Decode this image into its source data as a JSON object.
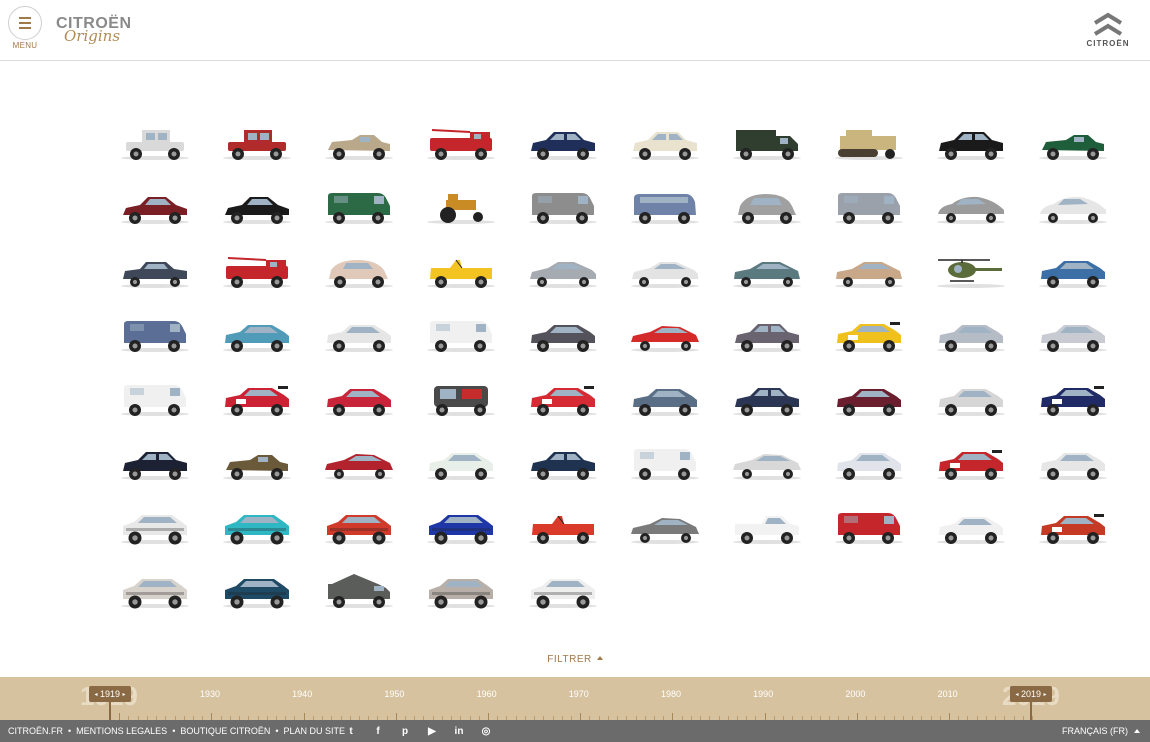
{
  "header": {
    "menu_label": "MENU",
    "brand": "CITROËN",
    "sub_brand": "Origins",
    "corner_logo_text": "CITROËN"
  },
  "cars": [
    {
      "type": "vintage",
      "color": "#d9d9d9"
    },
    {
      "type": "vintage",
      "color": "#b22b2b"
    },
    {
      "type": "roadster",
      "color": "#b9a88a"
    },
    {
      "type": "firetruck",
      "color": "#c4262b"
    },
    {
      "type": "sedan",
      "color": "#1f2f5a"
    },
    {
      "type": "sedan",
      "color": "#e8e2cf"
    },
    {
      "type": "truck",
      "color": "#2f3e2f"
    },
    {
      "type": "halftrack",
      "color": "#cbb57e"
    },
    {
      "type": "sedan",
      "color": "#1a1a1a"
    },
    {
      "type": "roadster",
      "color": "#1f5e3a"
    },
    {
      "type": "traction",
      "color": "#7a1f24"
    },
    {
      "type": "traction",
      "color": "#1a1a1a"
    },
    {
      "type": "van",
      "color": "#2c6a45"
    },
    {
      "type": "tractor",
      "color": "#c98b24"
    },
    {
      "type": "van",
      "color": "#8d8d8d"
    },
    {
      "type": "bus",
      "color": "#6f82a8"
    },
    {
      "type": "2cv",
      "color": "#a0a0a0"
    },
    {
      "type": "van",
      "color": "#9aa1aa"
    },
    {
      "type": "ds",
      "color": "#9b9b9b"
    },
    {
      "type": "ds",
      "color": "#e6e6e6"
    },
    {
      "type": "ami",
      "color": "#3f4859"
    },
    {
      "type": "firetruck",
      "color": "#c4262b"
    },
    {
      "type": "dyane",
      "color": "#e0c9b8"
    },
    {
      "type": "mehari",
      "color": "#f2c321"
    },
    {
      "type": "gs",
      "color": "#a6aab1"
    },
    {
      "type": "gs",
      "color": "#e3e3e3"
    },
    {
      "type": "cx",
      "color": "#5b7a80"
    },
    {
      "type": "cx",
      "color": "#c9a88a"
    },
    {
      "type": "helicopter",
      "color": "#5c6b3a"
    },
    {
      "type": "hatch",
      "color": "#3c6fa6"
    },
    {
      "type": "van",
      "color": "#5a6e96"
    },
    {
      "type": "hatch",
      "color": "#4f9bb8"
    },
    {
      "type": "hatch",
      "color": "#e6e6e6"
    },
    {
      "type": "van",
      "color": "#f0f0f0"
    },
    {
      "type": "hatch",
      "color": "#54525a"
    },
    {
      "type": "coupe",
      "color": "#d42a2a"
    },
    {
      "type": "sedan",
      "color": "#6a6470"
    },
    {
      "type": "rally",
      "color": "#f0c11d"
    },
    {
      "type": "hatch",
      "color": "#b6bcc6"
    },
    {
      "type": "hatch",
      "color": "#c8ccd2"
    },
    {
      "type": "van",
      "color": "#f0f0f0"
    },
    {
      "type": "rally",
      "color": "#cc2233"
    },
    {
      "type": "hatch",
      "color": "#c8253a"
    },
    {
      "type": "taxi",
      "color": "#4a4a4a"
    },
    {
      "type": "rally",
      "color": "#d62a35"
    },
    {
      "type": "hatch",
      "color": "#5a6f86"
    },
    {
      "type": "sedan",
      "color": "#2a3654"
    },
    {
      "type": "hatch",
      "color": "#6b1f2e"
    },
    {
      "type": "hatch",
      "color": "#d6d6d6"
    },
    {
      "type": "rally",
      "color": "#1f2a66"
    },
    {
      "type": "sedan",
      "color": "#1c2133"
    },
    {
      "type": "roadster",
      "color": "#6a5a3a"
    },
    {
      "type": "coupe",
      "color": "#b3232e"
    },
    {
      "type": "hatch",
      "color": "#e8eee8"
    },
    {
      "type": "sedan",
      "color": "#1f3350"
    },
    {
      "type": "van",
      "color": "#f0f0f0"
    },
    {
      "type": "coupe",
      "color": "#d8d8d8"
    },
    {
      "type": "hatch",
      "color": "#e0e4ea"
    },
    {
      "type": "rally",
      "color": "#c4262b"
    },
    {
      "type": "hatch",
      "color": "#e6e6e6"
    },
    {
      "type": "suv",
      "color": "#e8e8e8"
    },
    {
      "type": "suv",
      "color": "#2fb7c4"
    },
    {
      "type": "suv",
      "color": "#cf3a2a"
    },
    {
      "type": "suv",
      "color": "#1f37a6"
    },
    {
      "type": "mehari",
      "color": "#d93a2a"
    },
    {
      "type": "coupe",
      "color": "#7a7a7a"
    },
    {
      "type": "pickup",
      "color": "#f2f2f2"
    },
    {
      "type": "van",
      "color": "#c4262b"
    },
    {
      "type": "hatch",
      "color": "#f0f0f0"
    },
    {
      "type": "rally",
      "color": "#c43a24"
    },
    {
      "type": "suv",
      "color": "#d8d2cc"
    },
    {
      "type": "suv",
      "color": "#1f4a66"
    },
    {
      "type": "camper",
      "color": "#5a5d59"
    },
    {
      "type": "suv",
      "color": "#b8b0a8"
    },
    {
      "type": "suv",
      "color": "#eeeeee"
    }
  ],
  "filter": {
    "label": "FILTRER"
  },
  "timeline": {
    "start_handle": "1919",
    "end_handle": "2019",
    "ghost_start": "1919",
    "ghost_end": "2019",
    "decades": [
      "1930",
      "1940",
      "1950",
      "1960",
      "1970",
      "1980",
      "1990",
      "2000",
      "2010"
    ]
  },
  "footer": {
    "links": [
      "CITROËN.FR",
      "MENTIONS LEGALES",
      "BOUTIQUE CITROËN",
      "PLAN DU SITE"
    ],
    "social": [
      {
        "name": "twitter-icon",
        "glyph": "t"
      },
      {
        "name": "facebook-icon",
        "glyph": "f"
      },
      {
        "name": "pinterest-icon",
        "glyph": "p"
      },
      {
        "name": "youtube-icon",
        "glyph": "▶"
      },
      {
        "name": "linkedin-icon",
        "glyph": "in"
      },
      {
        "name": "instagram-icon",
        "glyph": "◎"
      }
    ],
    "language": "FRANÇAIS (FR)"
  }
}
